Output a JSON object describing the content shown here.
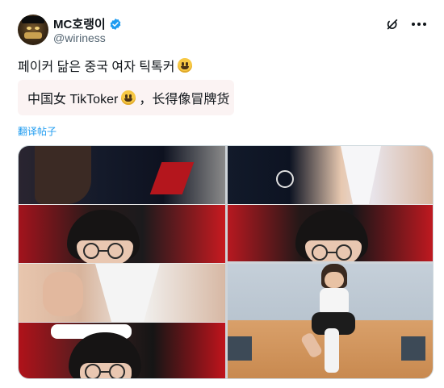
{
  "author": {
    "display_name": "MC호랭이",
    "handle": "@wiriness",
    "verified_color": "#1d9bf0"
  },
  "post": {
    "text": "페이커 닮은 중국 여자 틱톡커",
    "translated_text_before": "中国女 TikToker",
    "translated_text_after": "，长得像冒牌货",
    "translate_link": "翻译帖子"
  },
  "icons": {
    "emoji": "grinning-face-emoji",
    "grok": "grok-icon",
    "more": "more-icon"
  },
  "media": {
    "count": 3
  }
}
